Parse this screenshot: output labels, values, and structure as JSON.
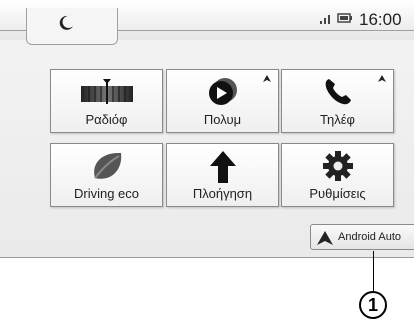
{
  "status": {
    "time": "16:00"
  },
  "tiles": [
    {
      "label": "Ραδιόφ"
    },
    {
      "label": "Πολυμ"
    },
    {
      "label": "Τηλέφ"
    },
    {
      "label": "Driving eco"
    },
    {
      "label": "Πλοήγηση"
    },
    {
      "label": "Ρυθμίσεις"
    }
  ],
  "android_auto": {
    "label": "Android Auto"
  },
  "callout": {
    "number": "1"
  },
  "icons": [
    "moon-icon",
    "signal-icon",
    "battery-icon",
    "radio-icon",
    "media-play-icon",
    "phone-icon",
    "leaf-icon",
    "navigation-arrow-icon",
    "gear-icon",
    "android-auto-icon",
    "badge-arrow-icon"
  ]
}
